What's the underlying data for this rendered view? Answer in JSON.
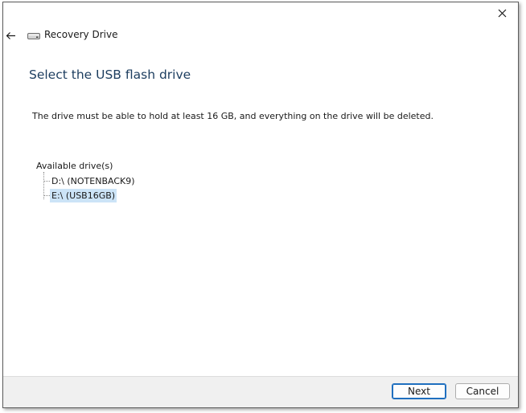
{
  "window": {
    "title": "Recovery Drive"
  },
  "page": {
    "heading": "Select the USB flash drive",
    "description": "The drive must be able to hold at least 16 GB, and everything on the drive will be deleted."
  },
  "drives": {
    "root_label": "Available drive(s)",
    "items": [
      {
        "label": "D:\\ (NOTENBACK9)",
        "selected": false
      },
      {
        "label": "E:\\ (USB16GB)",
        "selected": true
      }
    ]
  },
  "buttons": {
    "next": "Next",
    "cancel": "Cancel"
  },
  "colors": {
    "heading": "#1c3d5f",
    "selection": "#cce4f7",
    "footer_bg": "#f0f0f0",
    "default_button_border": "#1f6fbf"
  },
  "icons": {
    "close": "close-icon",
    "back": "back-arrow-icon",
    "drive": "drive-icon"
  }
}
